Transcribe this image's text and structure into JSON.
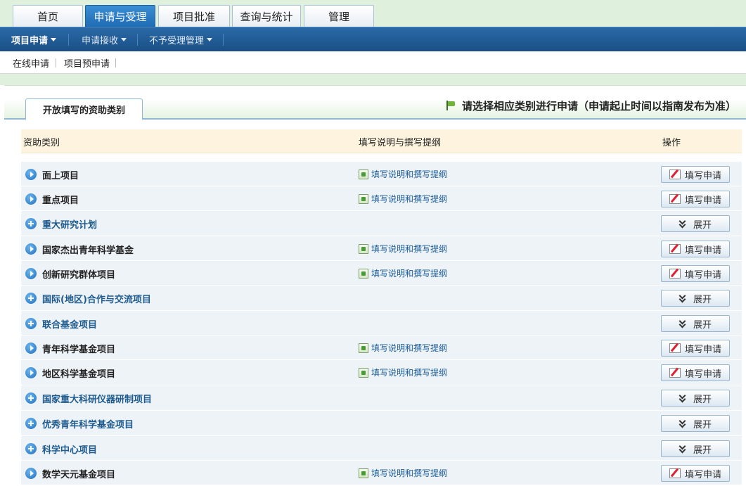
{
  "top_tabs": [
    {
      "label": "首页",
      "active": false
    },
    {
      "label": "申请与受理",
      "active": true
    },
    {
      "label": "项目批准",
      "active": false
    },
    {
      "label": "查询与统计",
      "active": false
    },
    {
      "label": "管理",
      "active": false
    }
  ],
  "nav": [
    {
      "label": "项目申请",
      "active": true
    },
    {
      "label": "申请接收",
      "active": false
    },
    {
      "label": "不予受理管理",
      "active": false
    }
  ],
  "subnav": [
    {
      "label": "在线申请"
    },
    {
      "label": "项目预申请"
    }
  ],
  "section_tab": "开放填写的资助类别",
  "hint": "请选择相应类别进行申请（申请起止时间以指南发布为准）",
  "columns": [
    "资助类别",
    "填写说明与撰写提纲",
    "操作"
  ],
  "guide_label": "填写说明和撰写提纲",
  "apply_label": "填写申请",
  "expand_label": "展开",
  "rows": [
    {
      "name": "面上项目",
      "kind": "apply"
    },
    {
      "name": "重点项目",
      "kind": "apply"
    },
    {
      "name": "重大研究计划",
      "kind": "expand"
    },
    {
      "name": "国家杰出青年科学基金",
      "kind": "apply"
    },
    {
      "name": "创新研究群体项目",
      "kind": "apply"
    },
    {
      "name": "国际(地区)合作与交流项目",
      "kind": "expand"
    },
    {
      "name": "联合基金项目",
      "kind": "expand"
    },
    {
      "name": "青年科学基金项目",
      "kind": "apply"
    },
    {
      "name": "地区科学基金项目",
      "kind": "apply"
    },
    {
      "name": "国家重大科研仪器研制项目",
      "kind": "expand"
    },
    {
      "name": "优秀青年科学基金项目",
      "kind": "expand"
    },
    {
      "name": "科学中心项目",
      "kind": "expand"
    },
    {
      "name": "数学天元基金项目",
      "kind": "apply"
    }
  ]
}
